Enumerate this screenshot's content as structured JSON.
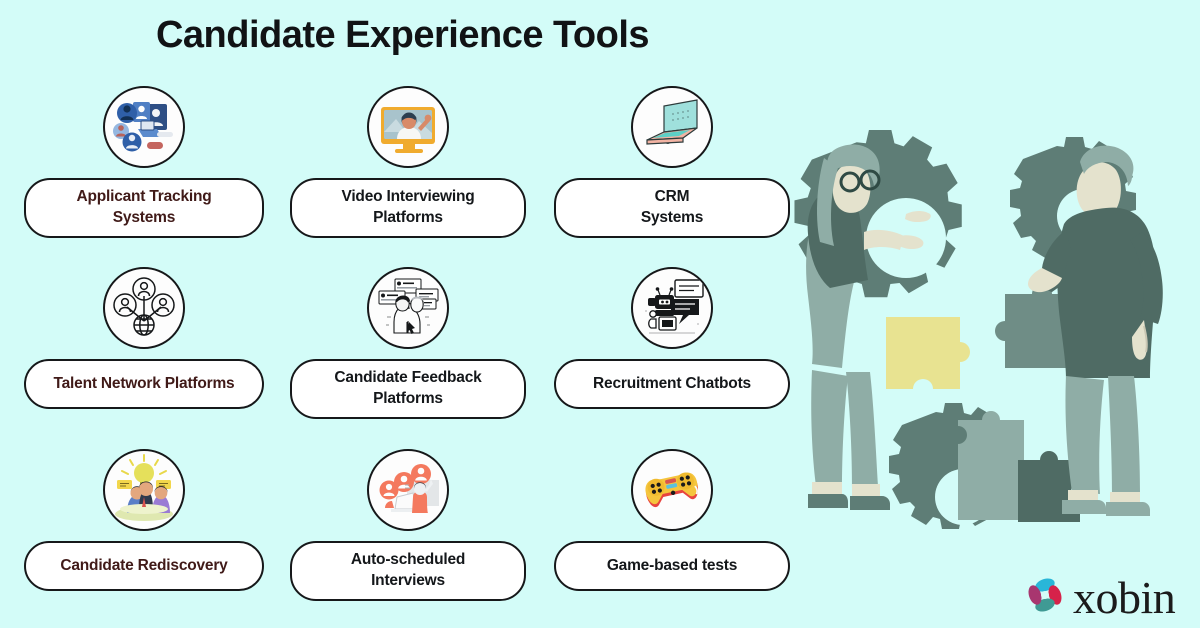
{
  "page": {
    "title": "Candidate Experience Tools",
    "background_color": "#d3fcf8"
  },
  "tools": [
    {
      "label_line1": "Applicant Tracking",
      "label_line2": "Systems",
      "icon": "applicant-tracking-systems-icon",
      "text_color": "#401a18"
    },
    {
      "label_line1": "Video Interviewing",
      "label_line2": "Platforms",
      "icon": "video-interviewing-icon",
      "text_color": "#14171a"
    },
    {
      "label_line1": "CRM",
      "label_line2": "Systems",
      "icon": "crm-laptop-icon",
      "text_color": "#14171a"
    },
    {
      "label_line1": "Talent Network Platforms",
      "label_line2": "",
      "icon": "talent-network-icon",
      "text_color": "#401a18"
    },
    {
      "label_line1": "Candidate Feedback",
      "label_line2": "Platforms",
      "icon": "candidate-feedback-icon",
      "text_color": "#14171a"
    },
    {
      "label_line1": "Recruitment Chatbots",
      "label_line2": "",
      "icon": "recruitment-chatbot-icon",
      "text_color": "#14171a"
    },
    {
      "label_line1": "Candidate Rediscovery",
      "label_line2": "",
      "icon": "candidate-rediscovery-icon",
      "text_color": "#401a18"
    },
    {
      "label_line1": "Auto-scheduled",
      "label_line2": "Interviews",
      "icon": "auto-scheduled-interviews-icon",
      "text_color": "#14171a"
    },
    {
      "label_line1": "Game-based tests",
      "label_line2": "",
      "icon": "game-based-tests-icon",
      "text_color": "#14171a"
    }
  ],
  "illustration": {
    "name": "teamwork-puzzle-gears-illustration",
    "gear_color": "#5e7d76",
    "puzzle_highlight_color": "#e8e391",
    "puzzle_color": "#6f8d86",
    "skin_color": "#e4e2cd",
    "shirt_color": "#4f6b64",
    "pants_color": "#89a5a0"
  },
  "logo": {
    "word": "xobin",
    "mark_name": "xobin-pinwheel-mark",
    "colors": {
      "top": "#29b6d8",
      "right": "#d6224a",
      "bottom": "#3f9a94",
      "left": "#a8366f"
    }
  }
}
